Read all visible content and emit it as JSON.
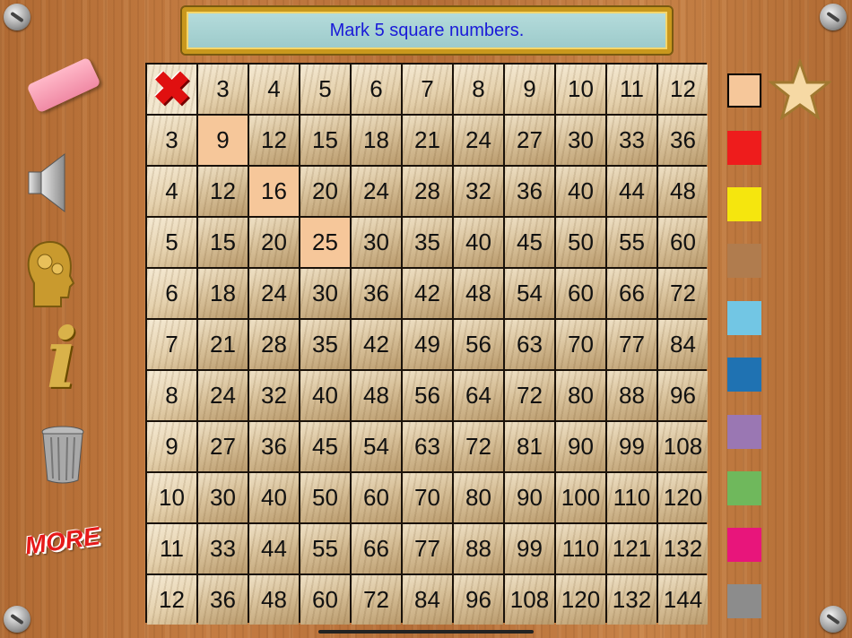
{
  "banner": {
    "text": "Mark 5 square numbers."
  },
  "grid": {
    "header_cols": [
      "3",
      "4",
      "5",
      "6",
      "7",
      "8",
      "9",
      "10",
      "11",
      "12"
    ],
    "rows": [
      {
        "label": "3",
        "cells": [
          "9",
          "12",
          "15",
          "18",
          "21",
          "24",
          "27",
          "30",
          "33",
          "36"
        ]
      },
      {
        "label": "4",
        "cells": [
          "12",
          "16",
          "20",
          "24",
          "28",
          "32",
          "36",
          "40",
          "44",
          "48"
        ]
      },
      {
        "label": "5",
        "cells": [
          "15",
          "20",
          "25",
          "30",
          "35",
          "40",
          "45",
          "50",
          "55",
          "60"
        ]
      },
      {
        "label": "6",
        "cells": [
          "18",
          "24",
          "30",
          "36",
          "42",
          "48",
          "54",
          "60",
          "66",
          "72"
        ]
      },
      {
        "label": "7",
        "cells": [
          "21",
          "28",
          "35",
          "42",
          "49",
          "56",
          "63",
          "70",
          "77",
          "84"
        ]
      },
      {
        "label": "8",
        "cells": [
          "24",
          "32",
          "40",
          "48",
          "56",
          "64",
          "72",
          "80",
          "88",
          "96"
        ]
      },
      {
        "label": "9",
        "cells": [
          "27",
          "36",
          "45",
          "54",
          "63",
          "72",
          "81",
          "90",
          "99",
          "108"
        ]
      },
      {
        "label": "10",
        "cells": [
          "30",
          "40",
          "50",
          "60",
          "70",
          "80",
          "90",
          "100",
          "110",
          "120"
        ]
      },
      {
        "label": "11",
        "cells": [
          "33",
          "44",
          "55",
          "66",
          "77",
          "88",
          "99",
          "110",
          "121",
          "132"
        ]
      },
      {
        "label": "12",
        "cells": [
          "36",
          "48",
          "60",
          "72",
          "84",
          "96",
          "108",
          "120",
          "132",
          "144"
        ]
      }
    ],
    "marked": [
      [
        0,
        0
      ],
      [
        1,
        1
      ],
      [
        2,
        2
      ]
    ],
    "mark_color": "#f6c79a"
  },
  "left_tools": {
    "eraser": "eraser-icon",
    "speaker": "speaker-icon",
    "head": "brain-gears-head-icon",
    "info": "info-icon",
    "info_glyph": "i",
    "trash": "trash-can-icon",
    "more_label": "MORE"
  },
  "palette": {
    "colors": [
      "#f6c79a",
      "#ee1c1c",
      "#f5e60e",
      "#b07c4e",
      "#72c6e4",
      "#1f72b2",
      "#9a77b3",
      "#6fb85c",
      "#e8157b",
      "#8c8c8c"
    ],
    "selected_index": 0
  },
  "star": "star-icon"
}
